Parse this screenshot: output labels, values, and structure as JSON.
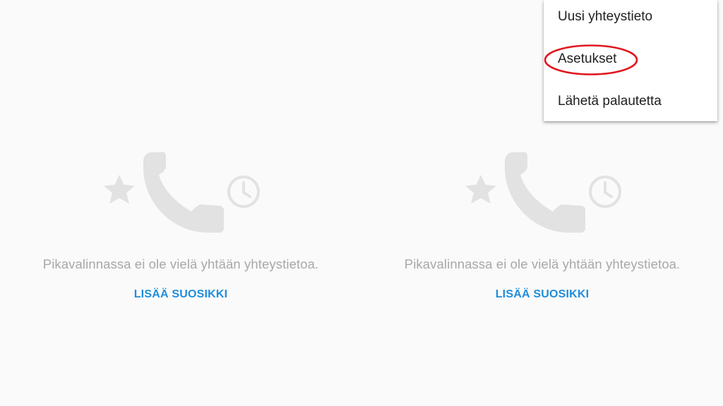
{
  "colors": {
    "background": "#fafafa",
    "illustration": "#e2e2e2",
    "empty_text": "#a8a8a8",
    "accent": "#1f8ddc",
    "menu_text": "#212121",
    "annotation_ring": "#e0171f"
  },
  "panels": [
    {
      "empty_message": "Pikavalinnassa ei ole vielä yhtään yhteystietoa.",
      "add_favorite_label": "LISÄÄ SUOSIKKI",
      "icons": [
        "star-icon",
        "phone-handset-icon",
        "clock-icon"
      ]
    },
    {
      "empty_message": "Pikavalinnassa ei ole vielä yhtään yhteystietoa.",
      "add_favorite_label": "LISÄÄ SUOSIKKI",
      "icons": [
        "star-icon",
        "phone-handset-icon",
        "clock-icon"
      ]
    }
  ],
  "overflow_menu": {
    "items": [
      {
        "label": "Uusi yhteystieto"
      },
      {
        "label": "Asetukset",
        "highlighted": true
      },
      {
        "label": "Lähetä palautetta"
      }
    ]
  }
}
